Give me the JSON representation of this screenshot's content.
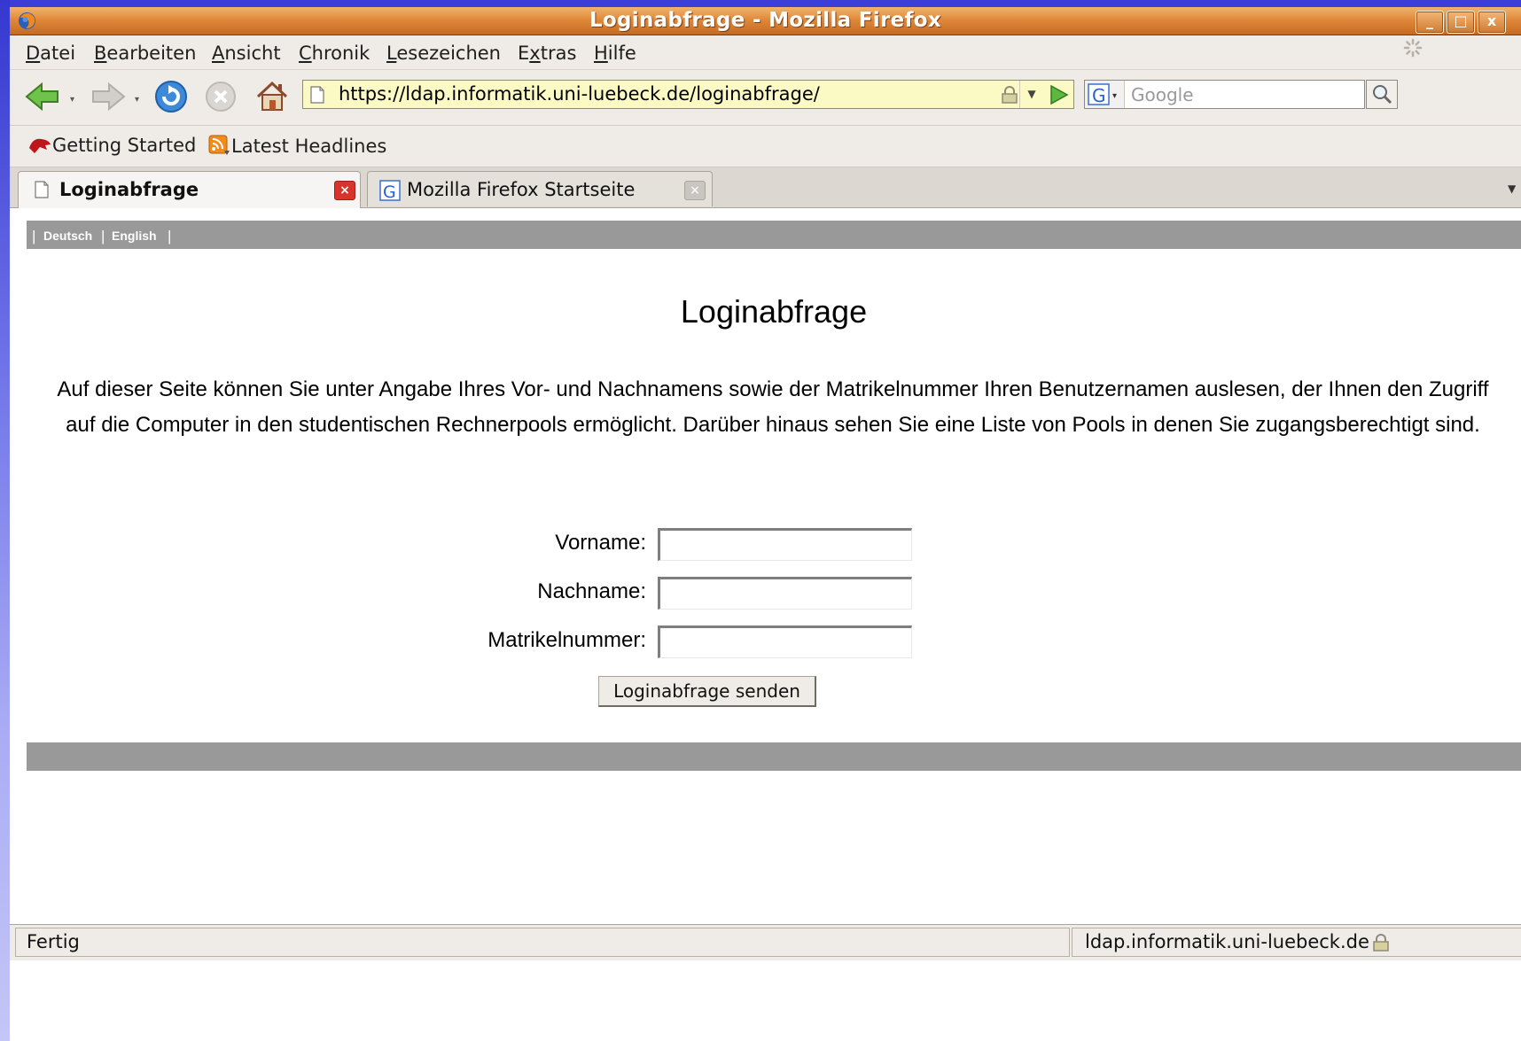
{
  "window": {
    "title": "Loginabfrage - Mozilla Firefox",
    "controls": {
      "minimize": "_",
      "maximize": "□",
      "close": "x"
    }
  },
  "menubar": {
    "items": [
      {
        "key": "D",
        "rest": "atei"
      },
      {
        "key": "B",
        "rest": "earbeiten"
      },
      {
        "key": "A",
        "rest": "nsicht"
      },
      {
        "key": "C",
        "rest": "hronik"
      },
      {
        "key": "L",
        "rest": "esezeichen"
      },
      {
        "pre": "E",
        "key": "x",
        "rest": "tras"
      },
      {
        "key": "H",
        "rest": "ilfe"
      }
    ]
  },
  "navbar": {
    "url": "https://ldap.informatik.uni-luebeck.de/loginabfrage/",
    "search_placeholder": "Google",
    "icons": [
      "back-icon",
      "forward-icon",
      "reload-icon",
      "stop-icon",
      "home-icon"
    ]
  },
  "bookmarks": [
    {
      "label": "Getting Started",
      "icon": "getting-started-icon"
    },
    {
      "label": "Latest Headlines",
      "icon": "rss-feed-icon"
    }
  ],
  "tabs": [
    {
      "label": "Loginabfrage",
      "active": true
    },
    {
      "label": "Mozilla Firefox Startseite",
      "active": false
    }
  ],
  "page": {
    "languages": [
      "Deutsch",
      "English"
    ],
    "heading": "Loginabfrage",
    "intro": "Auf dieser Seite können Sie unter Angabe Ihres Vor- und Nachnamens sowie der Matrikelnummer Ihren Benutzernamen auslesen, der Ihnen den Zugriff auf die Computer in den studentischen Rechnerpools ermöglicht. Darüber hinaus sehen Sie eine Liste von Pools in denen Sie zugangsberechtigt sind.",
    "form": {
      "firstname_label": "Vorname:",
      "firstname_value": "",
      "lastname_label": "Nachname:",
      "lastname_value": "",
      "matrikel_label": "Matrikelnummer:",
      "matrikel_value": "",
      "submit_label": "Loginabfrage senden"
    }
  },
  "statusbar": {
    "status": "Fertig",
    "host": "ldap.informatik.uni-luebeck.de"
  },
  "colors": {
    "titlebar": "#e0893a",
    "chrome": "#efebe7",
    "urlbar": "#fbf9c4",
    "page_bar": "#999999"
  }
}
